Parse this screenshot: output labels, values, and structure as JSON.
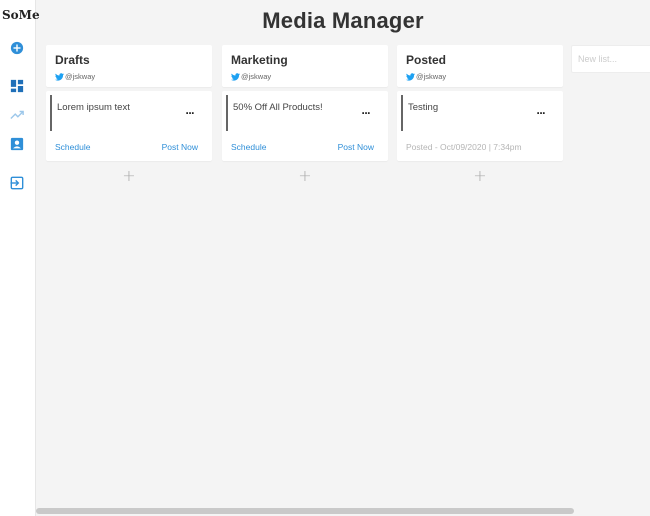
{
  "app": {
    "logo": "SoMe",
    "title": "Media Manager"
  },
  "sidebar": {
    "items": [
      {
        "name": "add-circle-icon",
        "color": "#2f8fd8"
      },
      {
        "name": "dashboard-icon",
        "color": "#1f6fb8"
      },
      {
        "name": "analytics-icon",
        "color": "#9cc7ea"
      },
      {
        "name": "portrait-icon",
        "color": "#2f8fd8"
      },
      {
        "name": "logout-icon",
        "color": "#2f8fd8"
      }
    ]
  },
  "lists": [
    {
      "title": "Drafts",
      "handle": "@jskway",
      "card": {
        "text": "Lorem ipsum text",
        "menu": "...",
        "schedule": "Schedule",
        "post_now": "Post Now"
      },
      "add": "+"
    },
    {
      "title": "Marketing",
      "handle": "@jskway",
      "card": {
        "text": "50% Off All Products!",
        "menu": "...",
        "schedule": "Schedule",
        "post_now": "Post Now"
      },
      "add": "+"
    },
    {
      "title": "Posted",
      "handle": "@jskway",
      "card": {
        "text": "Testing",
        "menu": "...",
        "posted_info": "Posted - Oct/09/2020 | 7:34pm"
      },
      "add": "+"
    }
  ],
  "new_list": {
    "placeholder": "New list..."
  },
  "colors": {
    "accent": "#2f8fd8",
    "twitter": "#1da1f2",
    "background": "#f4f4f4"
  }
}
